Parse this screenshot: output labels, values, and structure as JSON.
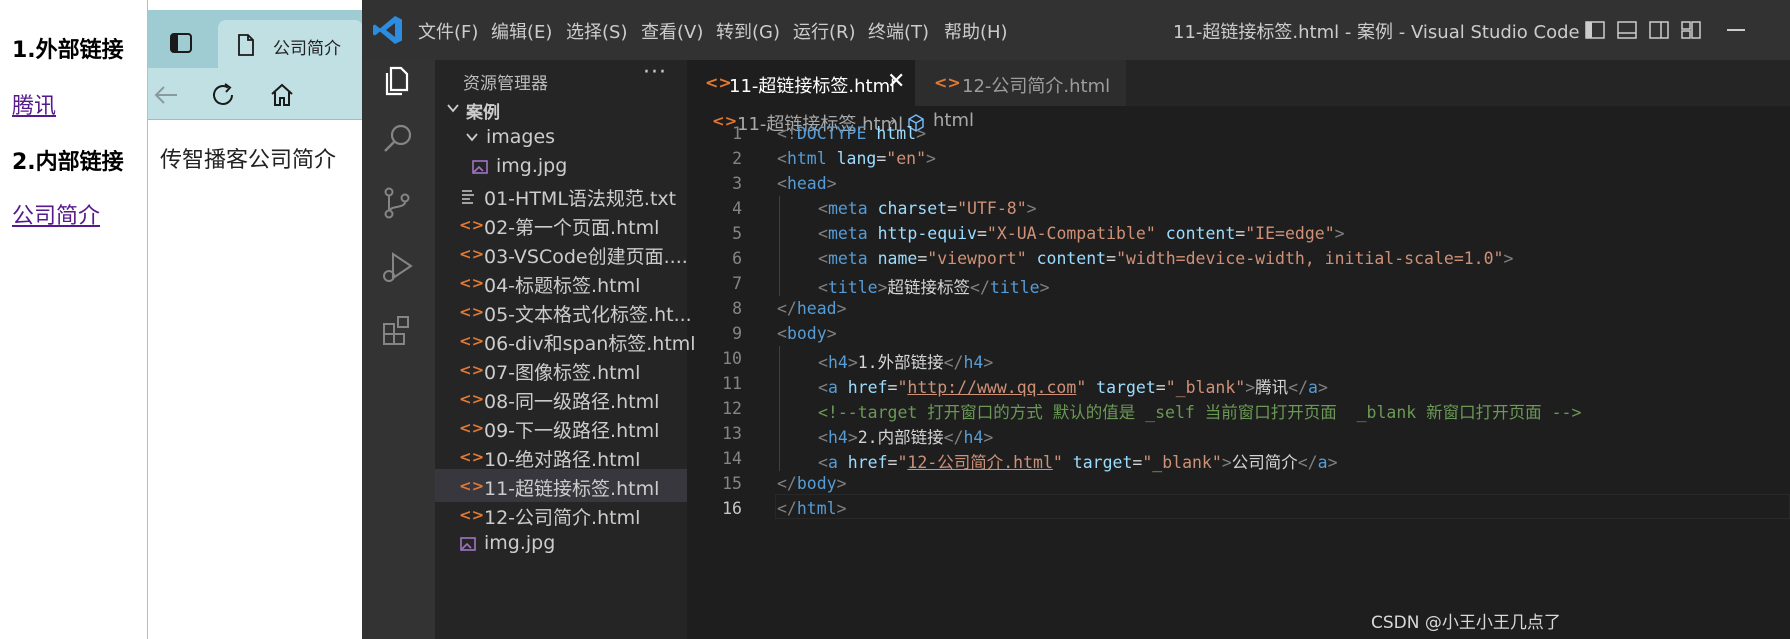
{
  "left_page": {
    "heading1": "1.外部链接",
    "link1": "腾讯",
    "heading2": "2.内部链接",
    "link2": "公司简介"
  },
  "browser": {
    "tab_title": "公司简介",
    "content_text": "传智播客公司简介",
    "colors": {
      "tabbar": "#9fcbd2",
      "toolbar": "#c1e0e4"
    }
  },
  "vscode": {
    "menu": [
      "文件(F)",
      "编辑(E)",
      "选择(S)",
      "查看(V)",
      "转到(G)",
      "运行(R)",
      "终端(T)",
      "帮助(H)"
    ],
    "window_title": "11-超链接标签.html - 案例 - Visual Studio Code",
    "sidebar": {
      "title": "资源管理器",
      "more": "···",
      "root_folder": "案例",
      "items": [
        {
          "label": "images",
          "type": "folder"
        },
        {
          "label": "img.jpg",
          "type": "image"
        },
        {
          "label": "01-HTML语法规范.txt",
          "type": "text"
        },
        {
          "label": "02-第一个页面.html",
          "type": "html"
        },
        {
          "label": "03-VSCode创建页面....",
          "type": "html"
        },
        {
          "label": "04-标题标签.html",
          "type": "html"
        },
        {
          "label": "05-文本格式化标签.ht...",
          "type": "html"
        },
        {
          "label": "06-div和span标签.html",
          "type": "html"
        },
        {
          "label": "07-图像标签.html",
          "type": "html"
        },
        {
          "label": "08-同一级路径.html",
          "type": "html"
        },
        {
          "label": "09-下一级路径.html",
          "type": "html"
        },
        {
          "label": "10-绝对路径.html",
          "type": "html"
        },
        {
          "label": "11-超链接标签.html",
          "type": "html",
          "selected": true
        },
        {
          "label": "12-公司简介.html",
          "type": "html"
        },
        {
          "label": "img.jpg",
          "type": "image"
        }
      ]
    },
    "tabs": [
      {
        "label": "11-超链接标签.html",
        "active": true,
        "close": "✕"
      },
      {
        "label": "12-公司简介.html",
        "active": false
      }
    ],
    "breadcrumbs": {
      "file": "11-超链接标签.html",
      "separator": "›",
      "element": "html"
    },
    "line_numbers": [
      "1",
      "2",
      "3",
      "4",
      "5",
      "6",
      "7",
      "8",
      "9",
      "10",
      "11",
      "12",
      "13",
      "14",
      "15",
      "16"
    ],
    "current_line": 16,
    "code": {
      "l1": {
        "open": "<!",
        "doctype": "DOCTYPE",
        "sp": " ",
        "kw": "html",
        "close": ">"
      },
      "l2": {
        "lt": "<",
        "tag": "html",
        "attr": " lang",
        "eq": "=",
        "val": "\"en\"",
        "gt": ">"
      },
      "l3": {
        "lt": "<",
        "tag": "head",
        "gt": ">"
      },
      "l4": {
        "lt": "<",
        "tag": "meta",
        "attr": " charset",
        "eq": "=",
        "val": "\"UTF-8\"",
        "gt": ">"
      },
      "l5": {
        "lt": "<",
        "tag": "meta",
        "attr1": " http-equiv",
        "eq1": "=",
        "val1": "\"X-UA-Compatible\"",
        "attr2": " content",
        "eq2": "=",
        "val2": "\"IE=edge\"",
        "gt": ">"
      },
      "l6": {
        "lt": "<",
        "tag": "meta",
        "attr1": " name",
        "eq1": "=",
        "val1": "\"viewport\"",
        "attr2": " content",
        "eq2": "=",
        "val2": "\"width=device-width, initial-scale=1.0\"",
        "gt": ">"
      },
      "l7": {
        "lt": "<",
        "tag": "title",
        "gt": ">",
        "text": "超链接标签",
        "lt2": "</",
        "tag2": "title",
        "gt2": ">"
      },
      "l8": {
        "lt": "</",
        "tag": "head",
        "gt": ">"
      },
      "l9": {
        "lt": "<",
        "tag": "body",
        "gt": ">"
      },
      "l10": {
        "lt": "<",
        "tag": "h4",
        "gt": ">",
        "text": "1.外部链接",
        "lt2": "</",
        "tag2": "h4",
        "gt2": ">"
      },
      "l11": {
        "lt": "<",
        "tag": "a",
        "attr1": " href",
        "eq1": "=",
        "q1": "\"",
        "url": "http://www.qq.com",
        "q2": "\"",
        "attr2": " target",
        "eq2": "=",
        "val2": "\"_blank\"",
        "gt": ">",
        "text": "腾讯",
        "lt2": "</",
        "tag2": "a",
        "gt2": ">"
      },
      "l12": {
        "comment": "<!--target 打开窗口的方式 默认的值是 _self 当前窗口打开页面  _blank 新窗口打开页面 -->"
      },
      "l13": {
        "lt": "<",
        "tag": "h4",
        "gt": ">",
        "text": "2.内部链接",
        "lt2": "</",
        "tag2": "h4",
        "gt2": ">"
      },
      "l14": {
        "lt": "<",
        "tag": "a",
        "attr1": " href",
        "eq1": "=",
        "q1": "\"",
        "url": "12-公司简介.html",
        "q2": "\"",
        "attr2": " target",
        "eq2": "=",
        "val2": "\"_blank\"",
        "gt": ">",
        "text": "公司简介",
        "lt2": "</",
        "tag2": "a",
        "gt2": ">"
      },
      "l15": {
        "lt": "</",
        "tag": "body",
        "gt": ">"
      },
      "l16": {
        "lt": "</",
        "tag": "html",
        "gt": ">"
      }
    },
    "colors": {
      "bg": "#1e1e1e",
      "titlebar": "#323233",
      "activitybar": "#333333",
      "sidebar": "#252526",
      "tag": "#569cd6",
      "attr": "#9cdcfe",
      "string": "#ce9178",
      "comment": "#6a9955",
      "html_icon": "#e37933"
    }
  },
  "watermark": "CSDN @小王小王几点了"
}
